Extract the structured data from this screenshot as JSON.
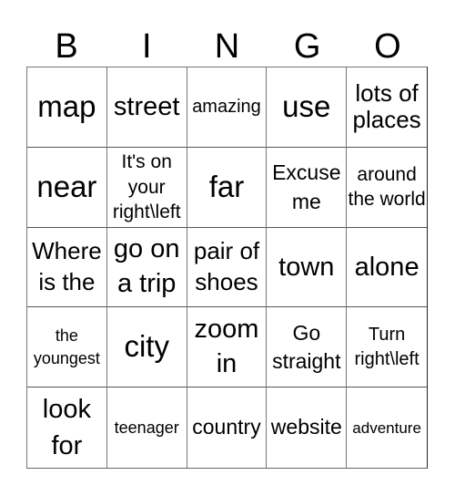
{
  "header": [
    "B",
    "I",
    "N",
    "G",
    "O"
  ],
  "cells": [
    [
      "map",
      "street",
      "amazing",
      "use",
      "lots of places"
    ],
    [
      "near",
      "It's on your right\\left",
      "far",
      "Excuse me",
      "around the world"
    ],
    [
      "Where is the",
      "go on a trip",
      "pair of shoes",
      "town",
      "alone"
    ],
    [
      "the youngest",
      "city",
      "zoom in",
      "Go straight",
      "Turn right\\left"
    ],
    [
      "look for",
      "teenager",
      "country",
      "website",
      "adventure"
    ]
  ]
}
